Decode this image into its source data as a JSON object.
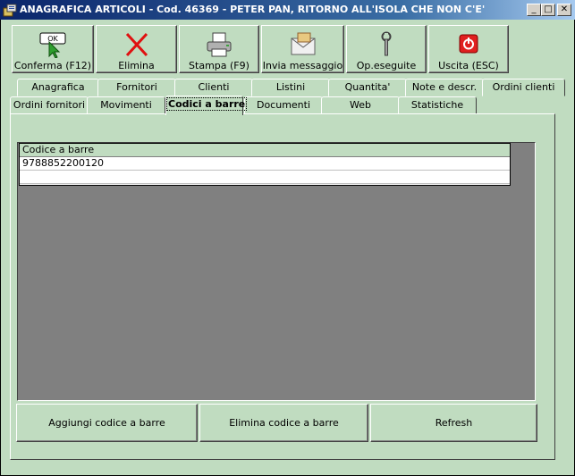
{
  "window": {
    "title": "ANAGRAFICA ARTICOLI - Cod. 46369 - PETER PAN, RITORNO ALL'ISOLA CHE NON C'E'",
    "minimize_glyph": "_",
    "maximize_glyph": "□",
    "close_glyph": "✕"
  },
  "toolbar": {
    "items": [
      {
        "label": "Conferma (F12)",
        "icon": "ok-icon",
        "icon_text": "OK"
      },
      {
        "label": "Elimina",
        "icon": "delete-x-icon"
      },
      {
        "label": "Stampa (F9)",
        "icon": "printer-icon"
      },
      {
        "label": "Invia messaggio",
        "icon": "envelope-icon"
      },
      {
        "label": "Op.eseguite",
        "icon": "wrench-icon"
      },
      {
        "label": "Uscita (ESC)",
        "icon": "power-icon"
      }
    ]
  },
  "tabs": {
    "row1": [
      "Anagrafica",
      "Fornitori",
      "Clienti",
      "Listini",
      "Quantita'",
      "Note e descr.",
      "Ordini clienti"
    ],
    "row2": [
      "Ordini fornitori",
      "Movimenti",
      "Codici a barre",
      "Documenti",
      "Web",
      "Statistiche"
    ],
    "active": "Codici a barre"
  },
  "grid": {
    "column_header": "Codice a barre",
    "rows": [
      "9788852200120",
      ""
    ]
  },
  "actions": {
    "add_barcode": "Aggiungi codice a barre",
    "delete_barcode": "Elimina codice a barre",
    "refresh": "Refresh"
  },
  "colors": {
    "background": "#c0dcc0",
    "titlebar": "#0a246a",
    "grid_area": "#808080"
  }
}
